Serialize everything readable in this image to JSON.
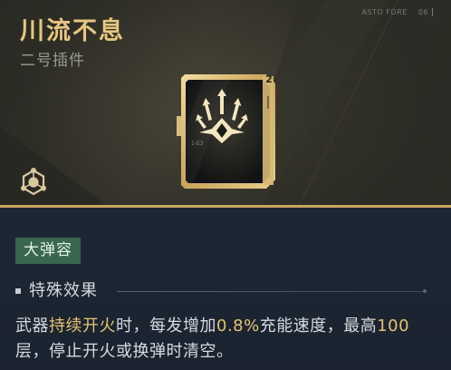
{
  "item": {
    "name": "川流不息",
    "subtitle": "二号插件",
    "corner_label": "ASTO FORE",
    "corner_number": "06",
    "level": "2",
    "code": "1-E3",
    "icon": "triple-arrow-burst-icon",
    "slot_icon": "hexagon-nodes-icon"
  },
  "tag": {
    "label": "大弹容",
    "color": "#39664f"
  },
  "effect": {
    "heading": "特殊效果",
    "description": {
      "part1": "武器",
      "highlight1": "持续开火",
      "part2": "时，每发增加",
      "highlight2": "0.8%",
      "part3": "充能速度，最高",
      "highlight3": "100",
      "part4": "层，停止开火或换弹时清空。"
    }
  },
  "colors": {
    "title_gold": "#e7c67f",
    "highlight_gold": "#e6c271",
    "accent_line": "#c8a65e",
    "body_bg": "#1b2430"
  }
}
